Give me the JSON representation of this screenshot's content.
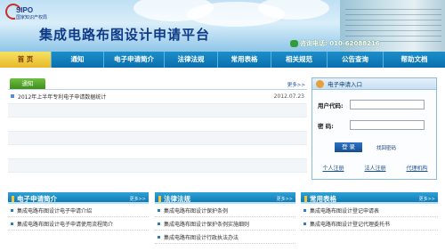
{
  "header": {
    "logo_text": "SIPO",
    "logo_sub": "国家知识产权局",
    "site_title": "集成电路布图设计申请平台",
    "phone": "咨询电话: 010-62088216"
  },
  "nav": {
    "items": [
      {
        "label": "首 页",
        "active": true
      },
      {
        "label": "通知"
      },
      {
        "label": "电子申请简介"
      },
      {
        "label": "法律法规"
      },
      {
        "label": "常用表格"
      },
      {
        "label": "相关规范"
      },
      {
        "label": "公告查询"
      },
      {
        "label": "帮助文档"
      }
    ]
  },
  "notice": {
    "tab_label": "通知",
    "more": "更多>>",
    "rows": [
      {
        "title": "2012年上半年专利电子申请数据统计",
        "date": "2012.07.23"
      },
      {
        "title": "",
        "date": ""
      },
      {
        "title": "",
        "date": ""
      },
      {
        "title": "",
        "date": ""
      },
      {
        "title": "",
        "date": ""
      },
      {
        "title": "",
        "date": ""
      }
    ]
  },
  "login": {
    "title": "电子申请入口",
    "user_label": "用户代码:",
    "password_label": "密    码:",
    "submit": "登 录",
    "forgot": "找回密码",
    "links": [
      "个人注册",
      "法人注册",
      "代理机构"
    ]
  },
  "columns": [
    {
      "title": "电子申请简介",
      "more": "更多>>",
      "items": [
        "集成电路布图设计电子申请介绍",
        "集成电路布图设计电子申请使用流程简介"
      ]
    },
    {
      "title": "法律法规",
      "more": "更多>>",
      "items": [
        "集成电路布图设计保护条例",
        "集成电路布图设计保护条例实施细则",
        "集成电路布图设计行政执法办法"
      ]
    },
    {
      "title": "常用表格",
      "more": "更多>>",
      "items": [
        "集成电路布图设计登记申请表",
        "集成电路布图设计登记代理委托书"
      ]
    }
  ],
  "colors": {
    "nav_blue": "#0a6fae",
    "nav_active": "#e8b92a",
    "title_blue": "#0f3a88",
    "notice_tab_green": "#3f8e1e"
  }
}
